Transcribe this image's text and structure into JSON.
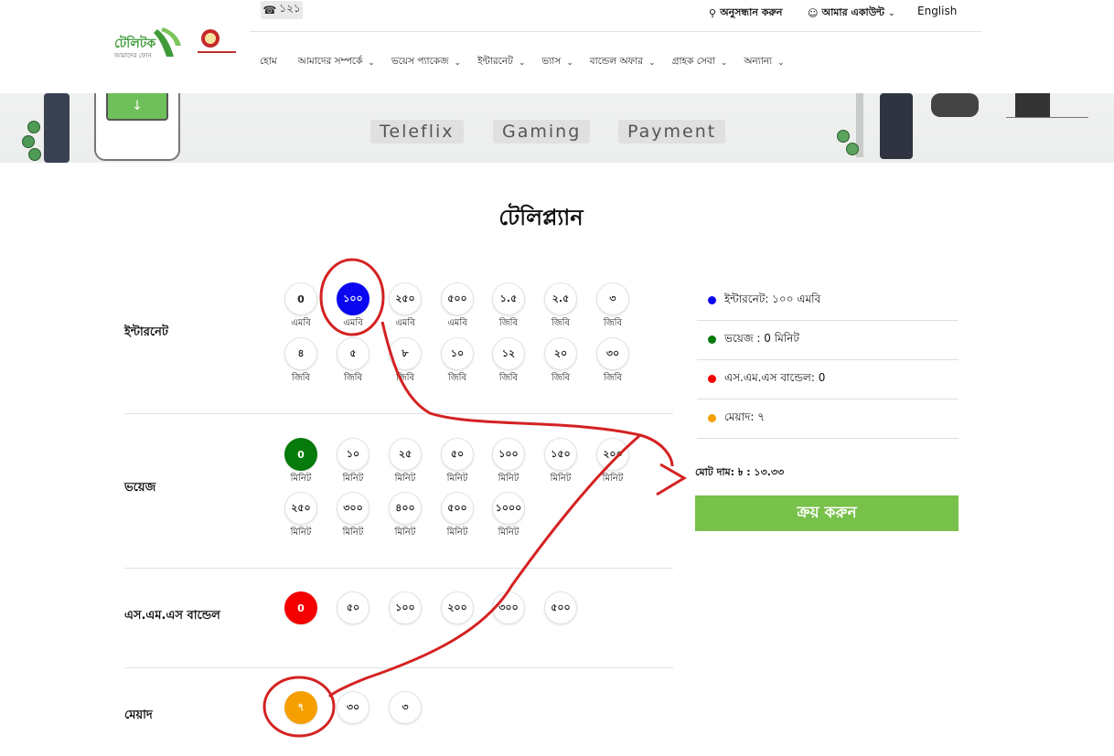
{
  "header": {
    "hotline": "১২১",
    "search_label": "অনুসন্ধান করুন",
    "account_label": "আমার একাউন্ট",
    "language_label": "English",
    "logo_text": "টেলিটক",
    "logo_sub": "আমাদের ফোন",
    "menu": [
      "হোম",
      "আমাদের সম্পর্কে",
      "ভয়েস প্যাকেজ",
      "ইন্টারনেট",
      "ভ্যাস",
      "বান্ডেল অফার",
      "গ্রাহক সেবা",
      "অন্যান্য"
    ]
  },
  "banner": {
    "chips": [
      "Teleflix",
      "Gaming",
      "Payment"
    ]
  },
  "page_title": "টেলিপ্ল্যান",
  "sections": {
    "internet": {
      "label": "ইন্টারনেট",
      "options": [
        {
          "value": "0",
          "unit": "এমবি"
        },
        {
          "value": "১০০",
          "unit": "এমবি"
        },
        {
          "value": "২৫০",
          "unit": "এমবি"
        },
        {
          "value": "৫০০",
          "unit": "এমবি"
        },
        {
          "value": "১.৫",
          "unit": "জিবি"
        },
        {
          "value": "২.৫",
          "unit": "জিবি"
        },
        {
          "value": "৩",
          "unit": "জিবি"
        },
        {
          "value": "৪",
          "unit": "জিবি"
        },
        {
          "value": "৫",
          "unit": "জিবি"
        },
        {
          "value": "৮",
          "unit": "জিবি"
        },
        {
          "value": "১০",
          "unit": "জিবি"
        },
        {
          "value": "১২",
          "unit": "জিবি"
        },
        {
          "value": "২০",
          "unit": "জিবি"
        },
        {
          "value": "৩০",
          "unit": "জিবি"
        }
      ]
    },
    "voice": {
      "label": "ভয়েজ",
      "options": [
        {
          "value": "0",
          "unit": "মিনিট"
        },
        {
          "value": "১০",
          "unit": "মিনিট"
        },
        {
          "value": "২৫",
          "unit": "মিনিট"
        },
        {
          "value": "৫০",
          "unit": "মিনিট"
        },
        {
          "value": "১০০",
          "unit": "মিনিট"
        },
        {
          "value": "১৫০",
          "unit": "মিনিট"
        },
        {
          "value": "২০০",
          "unit": "মিনিট"
        },
        {
          "value": "২৫০",
          "unit": "মিনিট"
        },
        {
          "value": "৩০০",
          "unit": "মিনিট"
        },
        {
          "value": "৪০০",
          "unit": "মিনিট"
        },
        {
          "value": "৫০০",
          "unit": "মিনিট"
        },
        {
          "value": "১০০০",
          "unit": "মিনিট"
        }
      ]
    },
    "sms": {
      "label": "এস.এম.এস বান্ডেল",
      "options": [
        {
          "value": "0"
        },
        {
          "value": "৫০"
        },
        {
          "value": "১০০"
        },
        {
          "value": "২০০"
        },
        {
          "value": "৩০০"
        },
        {
          "value": "৫০০"
        }
      ]
    },
    "validity": {
      "label": "মেয়াদ",
      "options": [
        {
          "value": "৭"
        },
        {
          "value": "৩০"
        },
        {
          "value": "৩"
        }
      ]
    }
  },
  "summary": {
    "internet": "ইন্টারনেট: ১০০ এমবি",
    "voice": "ভয়েজ : 0 মিনিট",
    "sms": "এস.এম.এস বান্ডেল: 0",
    "validity": "মেয়াদ: ৭",
    "total": "মোট দাম: ৳ : ১৩.৩৩",
    "buy_label": "ক্রয় করুন"
  },
  "colors": {
    "internet": "#0a06f0",
    "voice": "#067a0a",
    "sms": "#f40000",
    "validity": "#f5a000",
    "buy_button": "#78c14a",
    "annotation": "#d42222"
  }
}
